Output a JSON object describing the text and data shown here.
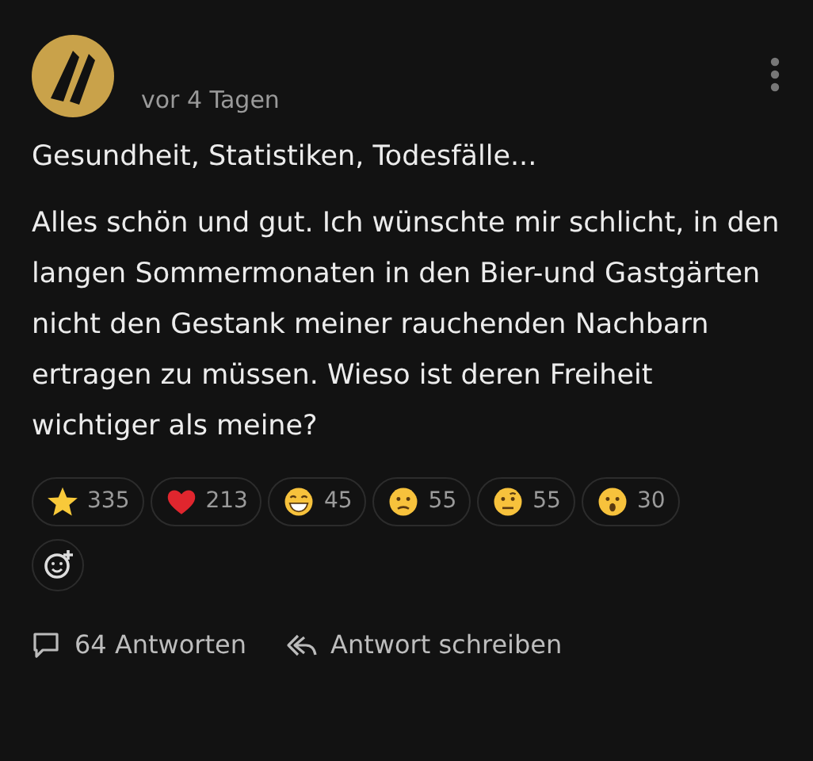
{
  "post": {
    "time": "vor 4 Tagen",
    "title": "Gesundheit, Statistiken, Todesfälle...",
    "body": "Alles schön und gut. Ich wünschte mir schlicht, in den langen Sommermonaten in den Bier-und Gastgärten nicht den Gestank meiner rauchenden Nachbarn ertragen zu müssen. Wieso ist deren Freiheit wichtiger als meine?"
  },
  "reactions": [
    {
      "kind": "star",
      "count": "335"
    },
    {
      "kind": "heart",
      "count": "213"
    },
    {
      "kind": "grin",
      "count": "45"
    },
    {
      "kind": "frown",
      "count": "55"
    },
    {
      "kind": "eyebrow",
      "count": "55"
    },
    {
      "kind": "surprised",
      "count": "30"
    }
  ],
  "footer": {
    "replies": "64 Antworten",
    "reply_action": "Antwort schreiben"
  }
}
